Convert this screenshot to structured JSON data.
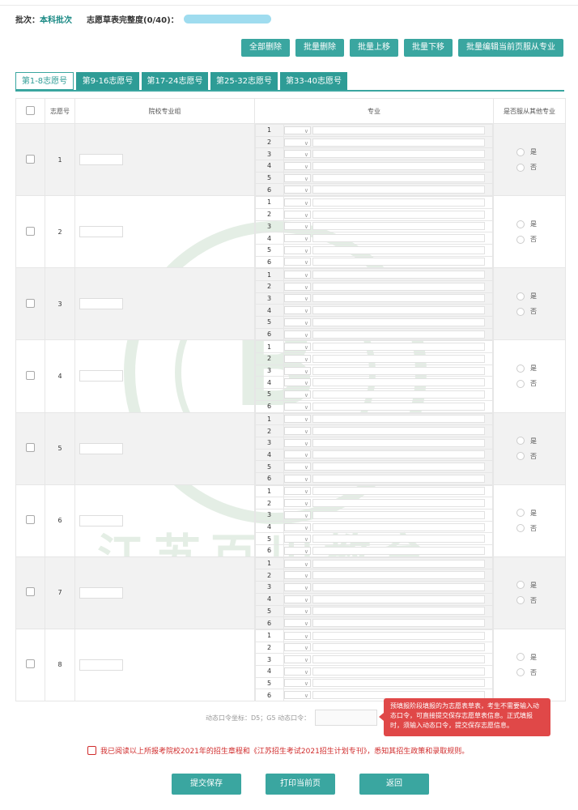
{
  "header": {
    "batch_label": "批次：",
    "batch_value": "本科批次",
    "completeness_label": "志愿草表完整度(0/40)："
  },
  "toolbar": {
    "buttons": [
      "全部删除",
      "批量删除",
      "批量上移",
      "批量下移",
      "批量编辑当前页服从专业"
    ]
  },
  "tabs": [
    "第1-8志愿号",
    "第9-16志愿号",
    "第17-24志愿号",
    "第25-32志愿号",
    "第33-40志愿号"
  ],
  "table": {
    "headers": [
      "志愿号",
      "院校专业组",
      "专业",
      "是否服从其他专业"
    ],
    "rows": [
      "1",
      "2",
      "3",
      "4",
      "5",
      "6",
      "7",
      "8"
    ],
    "major_slots": [
      "1",
      "2",
      "3",
      "4",
      "5",
      "6"
    ],
    "radio_yes": "是",
    "radio_no": "否"
  },
  "dynamic": {
    "label": "动态口令坐标：D5；G5 动态口令："
  },
  "tip": {
    "text": "预填报阶段填报的为志愿表草表，考生不需要输入动态口令，可直接提交保存志愿草表信息。正式填报时，须输入动态口令，提交保存志愿信息。"
  },
  "agree": {
    "text": "我已阅读以上所报考院校2021年的招生章程和《江苏招生考试2021招生计划专刊》，悉知其招生政策和录取规则。"
  },
  "bottom_buttons": [
    "提交保存",
    "打印当前页",
    "返回"
  ],
  "watermark": {
    "text": "江苏百川教育",
    "sub": "德 人 能 … 树 百 枝"
  },
  "colors": {
    "accent": "#3aa6a0",
    "tab": "#2e9c96",
    "tip": "#e04848",
    "progress": "#9fdcef"
  }
}
